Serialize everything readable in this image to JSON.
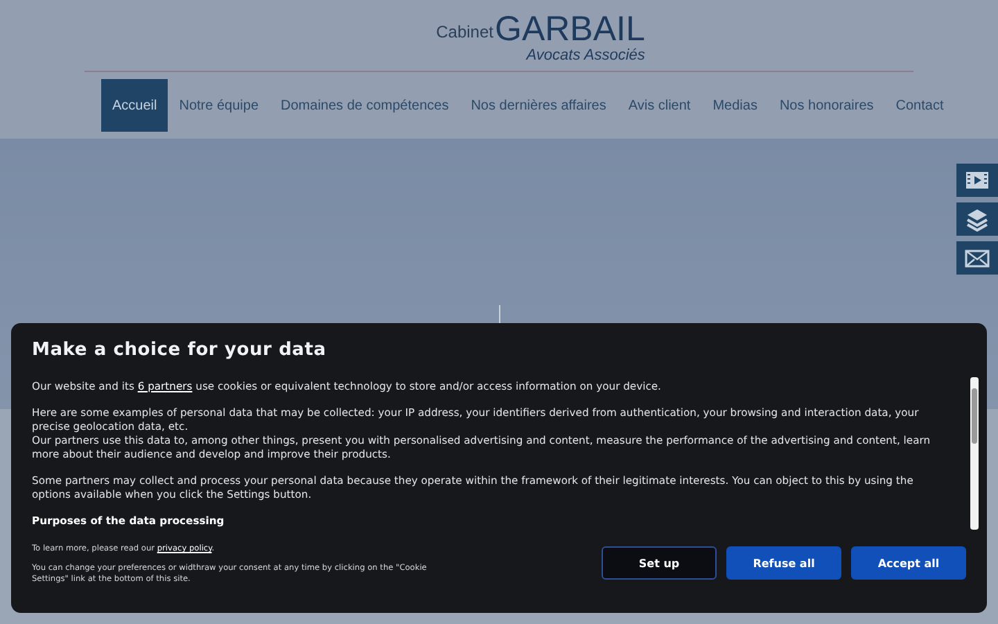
{
  "logo": {
    "prefix": "Cabinet",
    "name": "GARBAIL",
    "tagline": "Avocats Associés"
  },
  "nav": [
    {
      "label": "Accueil",
      "selected": true
    },
    {
      "label": "Notre équipe",
      "selected": false
    },
    {
      "label": "Domaines de compétences",
      "selected": false
    },
    {
      "label": "Nos dernières affaires",
      "selected": false
    },
    {
      "label": "Avis client",
      "selected": false
    },
    {
      "label": "Medias",
      "selected": false
    },
    {
      "label": "Nos honoraires",
      "selected": false
    },
    {
      "label": "Contact",
      "selected": false
    }
  ],
  "side_buttons": [
    {
      "kind": "video"
    },
    {
      "kind": "layers"
    },
    {
      "kind": "mail"
    }
  ],
  "consent": {
    "title": "Make a choice for your data",
    "paragraphs": [
      {
        "before": "Our website and its ",
        "link": "6 partners",
        "after": " use cookies or equivalent technology to store and/or access information on your device."
      },
      {
        "text": "Here are some examples of personal data that may be collected: your IP address, your identifiers derived from authentication, your browsing and interaction data, your precise geolocation data, etc."
      },
      {
        "text": "Our partners use this data to, among other things, present you with personalised advertising and content, measure the performance of the advertising and content, learn more about their audience and develop and improve their products."
      },
      {
        "text": "Some partners may collect and process your personal data because they operate within the framework of their legitimate interests. You can object to this by using the options available when you click the Settings button."
      }
    ],
    "purposes_heading": "Purposes of the data processing",
    "privacy": {
      "before": "To learn more, please read our ",
      "link": "privacy policy",
      "after": "."
    },
    "change_note": "You can change your preferences or widthraw your consent at any time by clicking on the \"Cookie Settings\" link at the bottom of this site.",
    "buttons": [
      {
        "label": "Set up",
        "kind": "outline"
      },
      {
        "label": "Refuse all",
        "kind": "solid"
      },
      {
        "label": "Accept all",
        "kind": "solid"
      }
    ]
  }
}
